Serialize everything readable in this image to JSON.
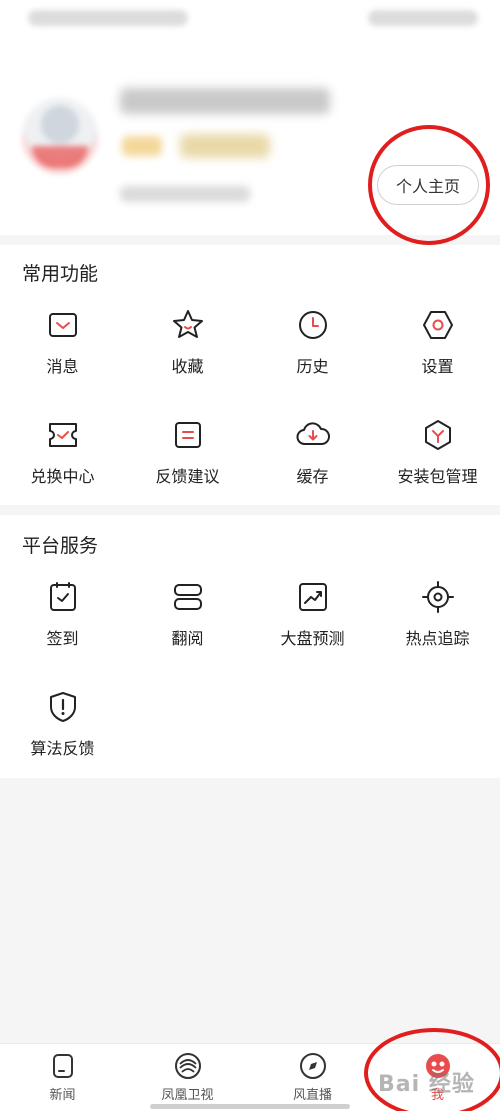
{
  "profile": {
    "home_button_label": "个人主页"
  },
  "common": {
    "title": "常用功能",
    "items": [
      {
        "label": "消息",
        "icon": "message-icon"
      },
      {
        "label": "收藏",
        "icon": "star-icon"
      },
      {
        "label": "历史",
        "icon": "clock-icon"
      },
      {
        "label": "设置",
        "icon": "gear-icon"
      },
      {
        "label": "兑换中心",
        "icon": "ticket-icon"
      },
      {
        "label": "反馈建议",
        "icon": "feedback-icon"
      },
      {
        "label": "缓存",
        "icon": "cloud-download-icon"
      },
      {
        "label": "安装包管理",
        "icon": "package-icon"
      }
    ]
  },
  "platform": {
    "title": "平台服务",
    "items": [
      {
        "label": "签到",
        "icon": "checkin-icon"
      },
      {
        "label": "翻阅",
        "icon": "book-icon"
      },
      {
        "label": "大盘预测",
        "icon": "trend-icon"
      },
      {
        "label": "热点追踪",
        "icon": "target-icon"
      },
      {
        "label": "算法反馈",
        "icon": "shield-alert-icon"
      }
    ]
  },
  "tabs": [
    {
      "label": "新闻",
      "icon": "news-icon"
    },
    {
      "label": "凤凰卫视",
      "icon": "phoenix-logo-icon"
    },
    {
      "label": "风直播",
      "icon": "compass-icon"
    },
    {
      "label": "我",
      "icon": "avatar-icon"
    }
  ],
  "watermark": "Bai 经验",
  "colors": {
    "accent": "#e84c4c",
    "annotation": "#e01e1e"
  }
}
